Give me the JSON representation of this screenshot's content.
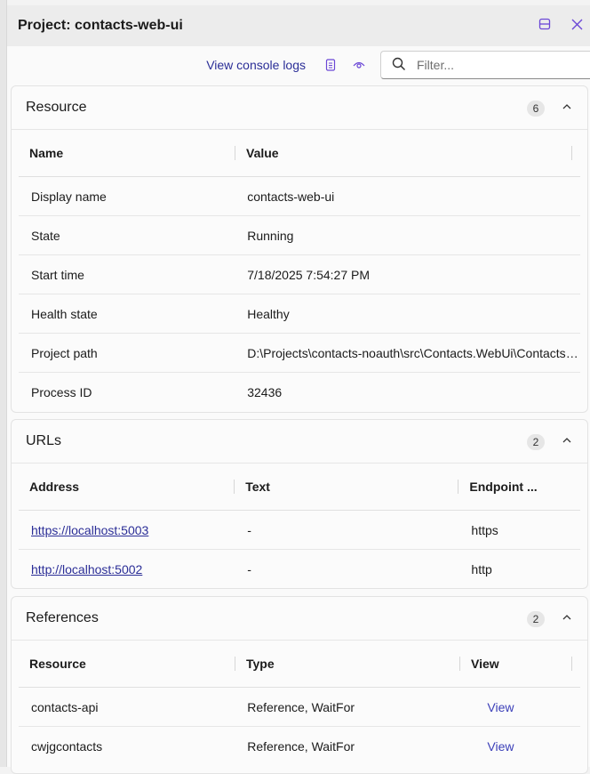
{
  "panel": {
    "title": "Project: contacts-web-ui"
  },
  "toolbar": {
    "console_logs_label": "View console logs",
    "filter_placeholder": "Filter..."
  },
  "resource": {
    "title": "Resource",
    "count": "6",
    "columns": [
      "Name",
      "Value"
    ],
    "rows": [
      {
        "name": "Display name",
        "value": "contacts-web-ui"
      },
      {
        "name": "State",
        "value": "Running"
      },
      {
        "name": "Start time",
        "value": "7/18/2025 7:54:27 PM"
      },
      {
        "name": "Health state",
        "value": "Healthy"
      },
      {
        "name": "Project path",
        "value": "D:\\Projects\\contacts-noauth\\src\\Contacts.WebUi\\Contacts.WebUi.csproj"
      },
      {
        "name": "Process ID",
        "value": "32436"
      }
    ]
  },
  "urls": {
    "title": "URLs",
    "count": "2",
    "columns": [
      "Address",
      "Text",
      "Endpoint ..."
    ],
    "rows": [
      {
        "address": "https://localhost:5003",
        "text": "-",
        "endpoint": "https"
      },
      {
        "address": "http://localhost:5002",
        "text": "-",
        "endpoint": "http"
      }
    ]
  },
  "references": {
    "title": "References",
    "count": "2",
    "columns": [
      "Resource",
      "Type",
      "View"
    ],
    "rows": [
      {
        "resource": "contacts-api",
        "type": "Reference, WaitFor",
        "view": "View"
      },
      {
        "resource": "cwjgcontacts",
        "type": "Reference, WaitFor",
        "view": "View"
      }
    ]
  },
  "colors": {
    "accent": "#6b47d6",
    "link": "#2b2e97"
  },
  "icons": [
    "dock-icon",
    "close-icon",
    "document-icon",
    "eye-icon",
    "search-icon",
    "chevron-up-icon"
  ]
}
